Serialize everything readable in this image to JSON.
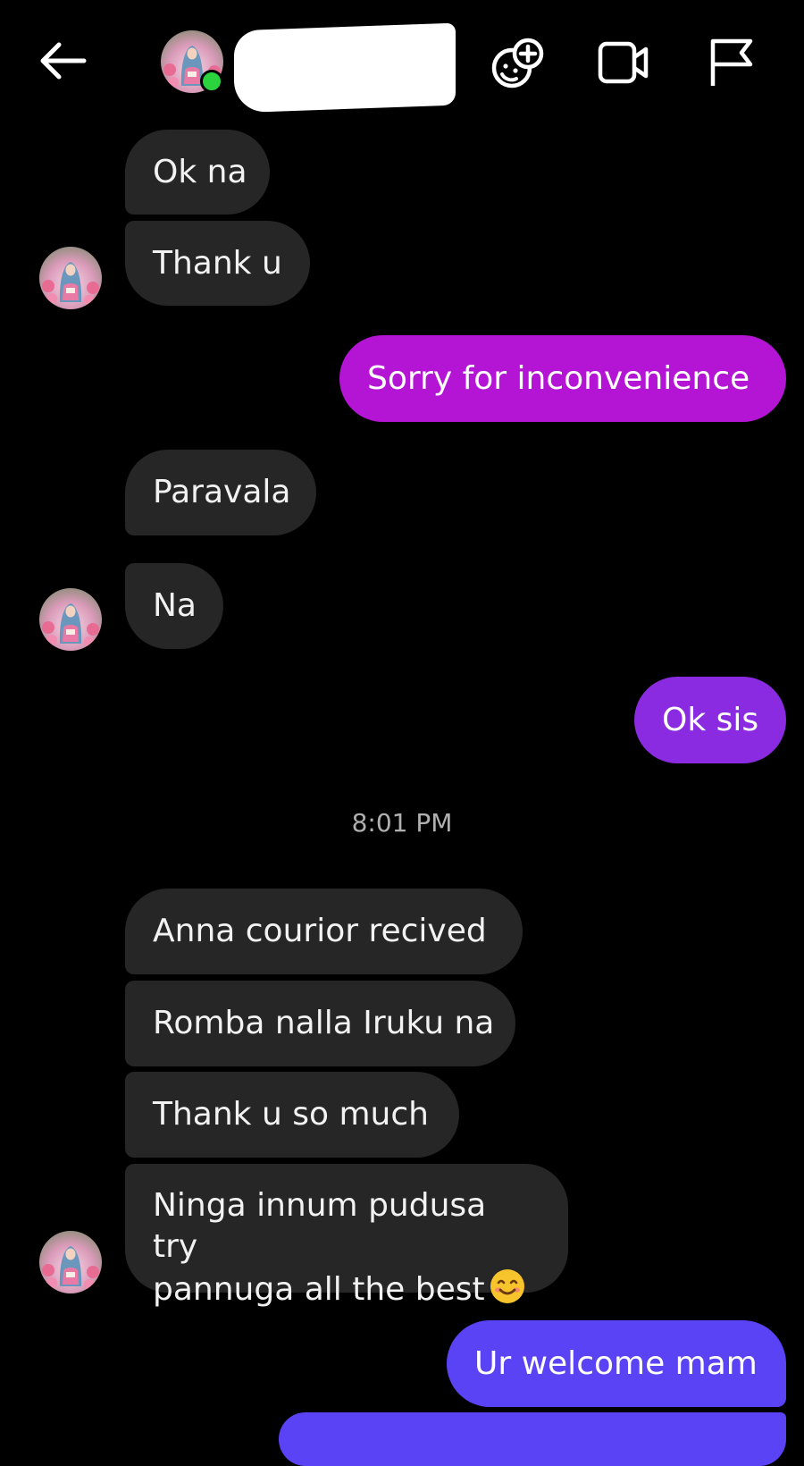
{
  "colors": {
    "background": "#000000",
    "incoming_bubble": "#262626",
    "outgoing_gradient_top": "#b414d4",
    "outgoing_gradient_mid": "#8a2be2",
    "outgoing_gradient_bottom": "#5a43f5",
    "online": "#2bd43f"
  },
  "header": {
    "icons": [
      "back-arrow-icon",
      "avatar",
      "effects-icon",
      "video-call-icon",
      "report-flag-icon"
    ]
  },
  "messages": [
    {
      "direction": "in",
      "text": "Ok na"
    },
    {
      "direction": "in",
      "text": "Thank u"
    },
    {
      "direction": "out",
      "text": "Sorry for inconvenience"
    },
    {
      "direction": "in",
      "text": "Paravala"
    },
    {
      "direction": "in",
      "text": "Na"
    },
    {
      "direction": "out",
      "text": "Ok sis"
    },
    {
      "direction": "in",
      "text": "Anna courior recived"
    },
    {
      "direction": "in",
      "text": "Romba nalla Iruku na"
    },
    {
      "direction": "in",
      "text": "Thank u so much"
    },
    {
      "direction": "in",
      "text_line1": "Ninga innum pudusa try",
      "text_line2": "pannuga all the best"
    },
    {
      "direction": "out",
      "text": "Ur welcome mam"
    }
  ],
  "timestamp": "8:01 PM"
}
